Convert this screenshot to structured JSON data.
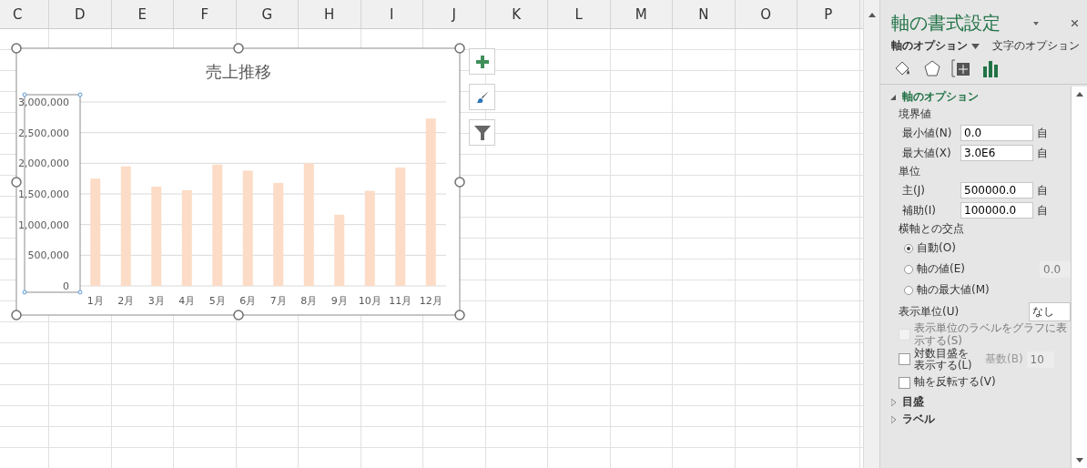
{
  "columns": [
    "C",
    "D",
    "E",
    "F",
    "G",
    "H",
    "I",
    "J",
    "K",
    "L",
    "M",
    "N",
    "O",
    "P"
  ],
  "chart": {
    "chart_data": {
      "type": "bar",
      "title": "売上推移",
      "categories": [
        "1月",
        "2月",
        "3月",
        "4月",
        "5月",
        "6月",
        "7月",
        "8月",
        "9月",
        "10月",
        "11月",
        "12月"
      ],
      "values": [
        1750000,
        1950000,
        1620000,
        1560000,
        1980000,
        1880000,
        1680000,
        2000000,
        1160000,
        1550000,
        1930000,
        2730000
      ],
      "ylim": [
        0,
        3000000
      ],
      "grid": true,
      "yticks": [
        {
          "value": 0,
          "label": "0"
        },
        {
          "value": 500000,
          "label": "500,000"
        },
        {
          "value": 1000000,
          "label": "1,000,000"
        },
        {
          "value": 1500000,
          "label": "1,500,000"
        },
        {
          "value": 2000000,
          "label": "2,000,000"
        },
        {
          "value": 2500000,
          "label": "2,500,000"
        },
        {
          "value": 3000000,
          "label": "3,000,000"
        }
      ]
    }
  },
  "panel": {
    "title": "軸の書式設定",
    "tabs": [
      {
        "label": "軸のオプション",
        "selected": true
      },
      {
        "label": "文字のオプション",
        "selected": false
      }
    ],
    "icon_tabs": [
      {
        "kind": "fill",
        "selected": false
      },
      {
        "kind": "effects",
        "selected": false
      },
      {
        "kind": "size",
        "selected": false
      },
      {
        "kind": "axis",
        "selected": true
      }
    ],
    "section": {
      "title": "軸のオプション",
      "expanded": true
    },
    "groups": [
      {
        "title": "境界値",
        "fields": [
          {
            "label": "最小値(N)",
            "value": "0.0",
            "reset": "自"
          },
          {
            "label": "最大値(X)",
            "value": "3.0E6",
            "reset": "自"
          }
        ]
      },
      {
        "title": "単位",
        "fields": [
          {
            "label": "主(J)",
            "value": "500000.0",
            "reset": "自"
          },
          {
            "label": "補助(I)",
            "value": "100000.0",
            "reset": "自"
          }
        ]
      }
    ],
    "crossing": {
      "title": "横軸との交点",
      "options": [
        {
          "label": "自動(O)",
          "selected": true
        },
        {
          "label": "軸の値(E)",
          "selected": false,
          "value": "0.0"
        },
        {
          "label": "軸の最大値(M)",
          "selected": false
        }
      ]
    },
    "display_unit": {
      "label": "表示単位(U)",
      "value": "なし"
    },
    "checkboxes": [
      {
        "label": "表示単位のラベルをグラフに表示する(S)",
        "checked": false,
        "disabled": true
      },
      {
        "label": "対数目盛を表示する(L)",
        "checked": false,
        "disabled": false,
        "base_label": "基数(B)",
        "base_value": "10"
      },
      {
        "label": "軸を反転する(V)",
        "checked": false,
        "disabled": false
      }
    ],
    "collapsed_sections": [
      {
        "title": "目盛",
        "expanded": false
      },
      {
        "title": "ラベル",
        "expanded": false
      }
    ]
  }
}
